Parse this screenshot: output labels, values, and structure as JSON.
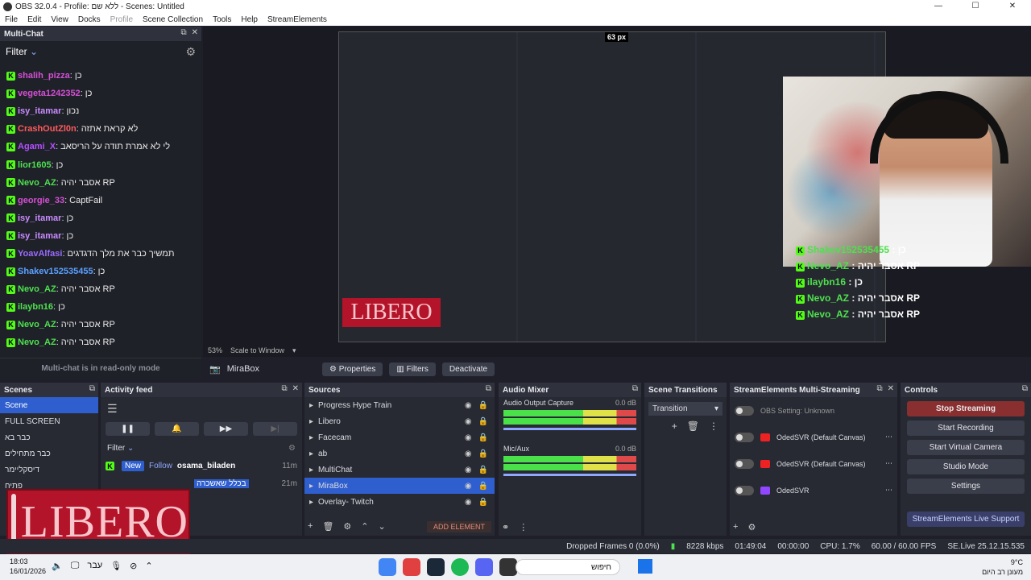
{
  "window": {
    "title": "OBS 32.0.4 - Profile: ללא שם - Scenes: Untitled"
  },
  "menu": [
    "File",
    "Edit",
    "View",
    "Docks",
    "Profile",
    "Scene Collection",
    "Tools",
    "Help",
    "StreamElements"
  ],
  "multichat": {
    "title": "Multi-Chat",
    "filter_label": "Filter",
    "readonly_notice": "Multi-chat is in read-only mode",
    "messages": [
      {
        "user": "shalih_pizza",
        "text": "כן",
        "color": "#d44fd4"
      },
      {
        "user": "vegeta1242352",
        "text": "כן",
        "color": "#d44fd4"
      },
      {
        "user": "isy_itamar",
        "text": "נכון",
        "color": "#c98cff"
      },
      {
        "user": "CrashOutZl0n",
        "text": "לא קראת אתזה",
        "color": "#ff5a5a"
      },
      {
        "user": "Agami_X",
        "text": "לי לא אמרת תודה על הריסאב",
        "color": "#b44fff"
      },
      {
        "user": "lior1605",
        "text": "כן",
        "color": "#4ee14e"
      },
      {
        "user": "Nevo_AZ",
        "text": "אסבר יהיה RP",
        "color": "#4ee14e"
      },
      {
        "user": "georgie_33",
        "text": "CaptFail",
        "color": "#d44fd4"
      },
      {
        "user": "isy_itamar",
        "text": "כן",
        "color": "#c98cff"
      },
      {
        "user": "isy_itamar",
        "text": "כן",
        "color": "#c98cff"
      },
      {
        "user": "YoavAlfasi",
        "text": "תמשיך כבר את מלך הדגדגים",
        "color": "#9b6bff"
      },
      {
        "user": "Shakev152535455",
        "text": "כן",
        "color": "#5aa0ff"
      },
      {
        "user": "Nevo_AZ",
        "text": "אסבר יהיה RP",
        "color": "#4ee14e"
      },
      {
        "user": "ilaybn16",
        "text": "כן",
        "color": "#4ee14e"
      },
      {
        "user": "Nevo_AZ",
        "text": "אסבר יהיה RP",
        "color": "#4ee14e"
      },
      {
        "user": "Nevo_AZ",
        "text": "אסבר יהיה RP",
        "color": "#4ee14e"
      }
    ]
  },
  "preview": {
    "dimension_label": "63 px",
    "zoom": "53%",
    "scale_mode": "Scale to Window",
    "overlay_chat": [
      {
        "user": "Shakev152535455",
        "text": "כן"
      },
      {
        "user": "Nevo_AZ",
        "text": "אסבר יהיה RP"
      },
      {
        "user": "ilaybn16",
        "text": "כן"
      },
      {
        "user": "Nevo_AZ",
        "text": "אסבר יהיה RP"
      },
      {
        "user": "Nevo_AZ",
        "text": "אסבר יהיה RP"
      }
    ]
  },
  "source_toolbar": {
    "source": "MiraBox",
    "properties": "Properties",
    "filters": "Filters",
    "deactivate": "Deactivate"
  },
  "scenes": {
    "title": "Scenes",
    "items": [
      "Scene",
      "FULL SCREEN",
      "כבר בא",
      "כבר מתחילים",
      "דיסקליימר",
      "פתיח"
    ]
  },
  "activity": {
    "title": "Activity feed",
    "filter_label": "Filter",
    "event_badge_new": "New",
    "event_type": "Follow",
    "event_user": "osama_biladen",
    "event_time": "11m",
    "event_time2": "21m",
    "event_text2": "בכלל שאשכרה"
  },
  "sources": {
    "title": "Sources",
    "items": [
      "Progress Hype Train",
      "Libero",
      "Facecam",
      "ab",
      "MultiChat",
      "MiraBox",
      "Overlay- Twitch"
    ],
    "add_element": "ADD ELEMENT"
  },
  "audio": {
    "title": "Audio Mixer",
    "channels": [
      {
        "name": "Audio Output Capture",
        "db": "0.0 dB"
      },
      {
        "name": "Mic/Aux",
        "db": "0.0 dB"
      }
    ],
    "scale": [
      "-60",
      "-55",
      "-50",
      "-45",
      "-40",
      "-35",
      "-30",
      "-25",
      "-20",
      "-15",
      "-10",
      "-5",
      "0"
    ]
  },
  "transitions": {
    "title": "Scene Transitions",
    "selected": "Transition"
  },
  "multistream": {
    "title": "StreamElements Multi-Streaming",
    "status": "OBS Setting: Unknown",
    "rows": [
      "OdedSVR (Default Canvas)",
      "OdedSVR (Default Canvas)",
      "OdedSVR"
    ]
  },
  "controls": {
    "title": "Controls",
    "buttons": [
      "Stop Streaming",
      "Start Recording",
      "Start Virtual Camera",
      "Studio Mode",
      "Settings"
    ],
    "live_support": "StreamElements Live Support"
  },
  "status": {
    "dropped": "Dropped Frames 0 (0.0%)",
    "bitrate": "8228 kbps",
    "live_time": "01:49:04",
    "rec_time": "00:00:00",
    "cpu": "CPU: 1.7%",
    "fps": "60.00 / 60.00 FPS",
    "version": "SE.Live 25.12.15.535"
  },
  "libero": {
    "brand": "LIBERO"
  },
  "taskbar": {
    "time": "18:03",
    "date": "16/01/2026",
    "lang": "עבר",
    "search": "חיפוש",
    "weather_temp": "9°C",
    "weather_desc": "מעונן רב היום"
  }
}
